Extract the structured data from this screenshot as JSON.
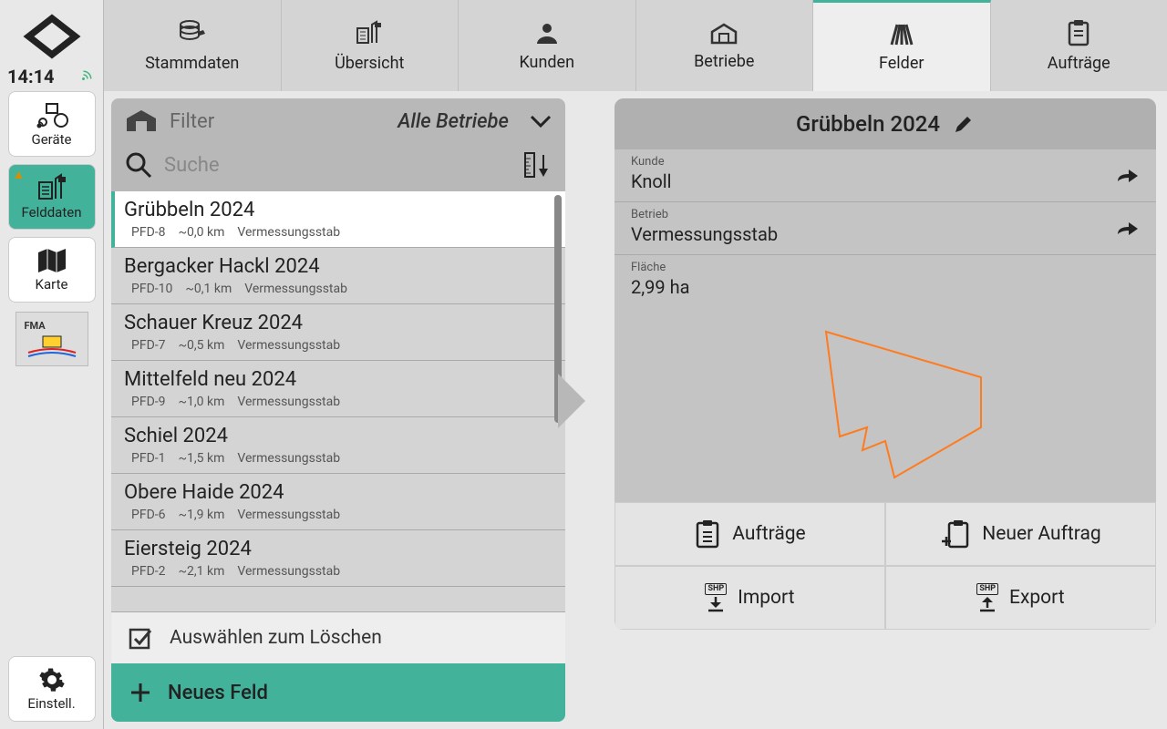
{
  "time": "14:14",
  "sidebar": {
    "items": [
      {
        "label": "Geräte"
      },
      {
        "label": "Felddaten"
      },
      {
        "label": "Karte"
      },
      {
        "label": ""
      }
    ],
    "settings_label": "Einstell."
  },
  "tabs": [
    {
      "label": "Stammdaten"
    },
    {
      "label": "Übersicht"
    },
    {
      "label": "Kunden"
    },
    {
      "label": "Betriebe"
    },
    {
      "label": "Felder"
    },
    {
      "label": "Aufträge"
    }
  ],
  "filter": {
    "label": "Filter",
    "value": "Alle Betriebe"
  },
  "search": {
    "placeholder": "Suche"
  },
  "list": [
    {
      "title": "Grübbeln 2024",
      "id": "PFD-8",
      "dist": "~0,0 km",
      "src": "Vermessungsstab",
      "selected": true
    },
    {
      "title": "Bergacker Hackl 2024",
      "id": "PFD-10",
      "dist": "~0,1 km",
      "src": "Vermessungsstab"
    },
    {
      "title": "Schauer Kreuz 2024",
      "id": "PFD-7",
      "dist": "~0,5 km",
      "src": "Vermessungsstab"
    },
    {
      "title": "Mittelfeld neu 2024",
      "id": "PFD-9",
      "dist": "~1,0 km",
      "src": "Vermessungsstab"
    },
    {
      "title": "Schiel 2024",
      "id": "PFD-1",
      "dist": "~1,5 km",
      "src": "Vermessungsstab"
    },
    {
      "title": "Obere Haide 2024",
      "id": "PFD-6",
      "dist": "~1,9 km",
      "src": "Vermessungsstab"
    },
    {
      "title": "Eiersteig 2024",
      "id": "PFD-2",
      "dist": "~2,1 km",
      "src": "Vermessungsstab"
    }
  ],
  "select_delete_label": "Auswählen zum Löschen",
  "new_field_label": "Neues Feld",
  "detail": {
    "title": "Grübbeln 2024",
    "kunde_label": "Kunde",
    "kunde_value": "Knoll",
    "betrieb_label": "Betrieb",
    "betrieb_value": "Vermessungsstab",
    "flaeche_label": "Fläche",
    "flaeche_value": "2,99 ha",
    "actions": {
      "auftraege": "Aufträge",
      "neuer_auftrag": "Neuer Auftrag",
      "import": "Import",
      "export": "Export",
      "shp": "SHP"
    }
  }
}
